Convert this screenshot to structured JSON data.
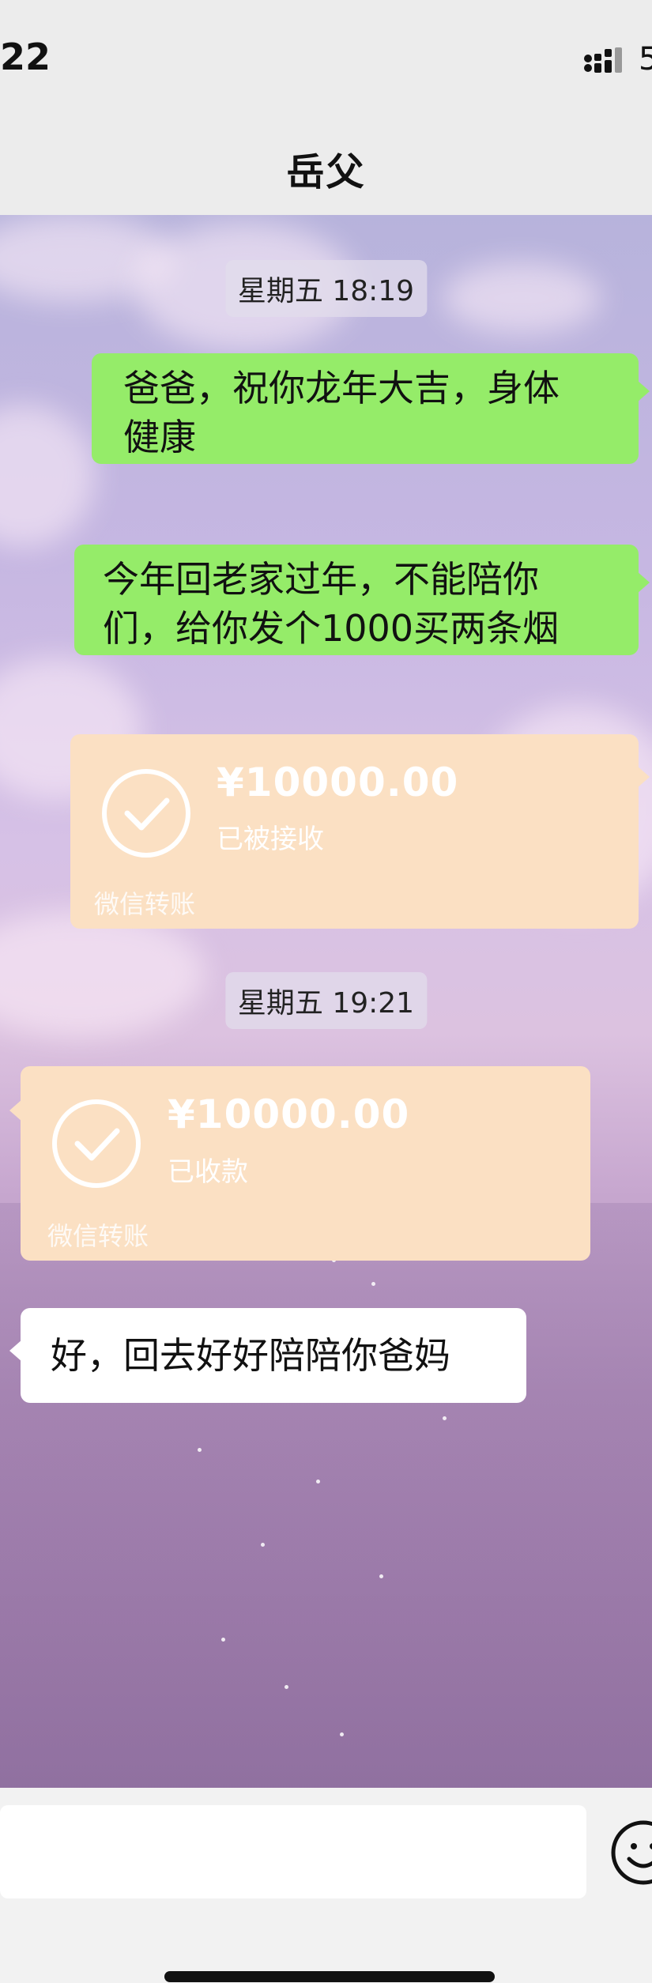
{
  "status_bar": {
    "time": "22",
    "battery_partial": "5"
  },
  "nav": {
    "title": "岳父"
  },
  "messages": [
    {
      "type": "timestamp",
      "text": "星期五 18:19"
    },
    {
      "type": "text",
      "side": "right",
      "lines": [
        "爸爸，祝你龙年大吉，身体",
        "健康"
      ]
    },
    {
      "type": "text",
      "side": "right",
      "lines": [
        "今年回老家过年，不能陪你",
        "们，给你发个1000买两条烟"
      ]
    },
    {
      "type": "transfer",
      "side": "right",
      "amount": "¥10000.00",
      "status": "已被接收",
      "label": "微信转账"
    },
    {
      "type": "timestamp",
      "text": "星期五 19:21"
    },
    {
      "type": "transfer",
      "side": "left",
      "amount": "¥10000.00",
      "status": "已收款",
      "label": "微信转账"
    },
    {
      "type": "text",
      "side": "left",
      "lines": [
        "好，回去好好陪陪你爸妈"
      ]
    }
  ],
  "colors": {
    "sent_bubble": "#95ec69",
    "received_bubble": "#ffffff",
    "transfer_card": "#fbe0c3",
    "chrome": "#ececec"
  },
  "icons": [
    "signal-bars-icon",
    "check-circle-icon",
    "emoji-icon"
  ]
}
